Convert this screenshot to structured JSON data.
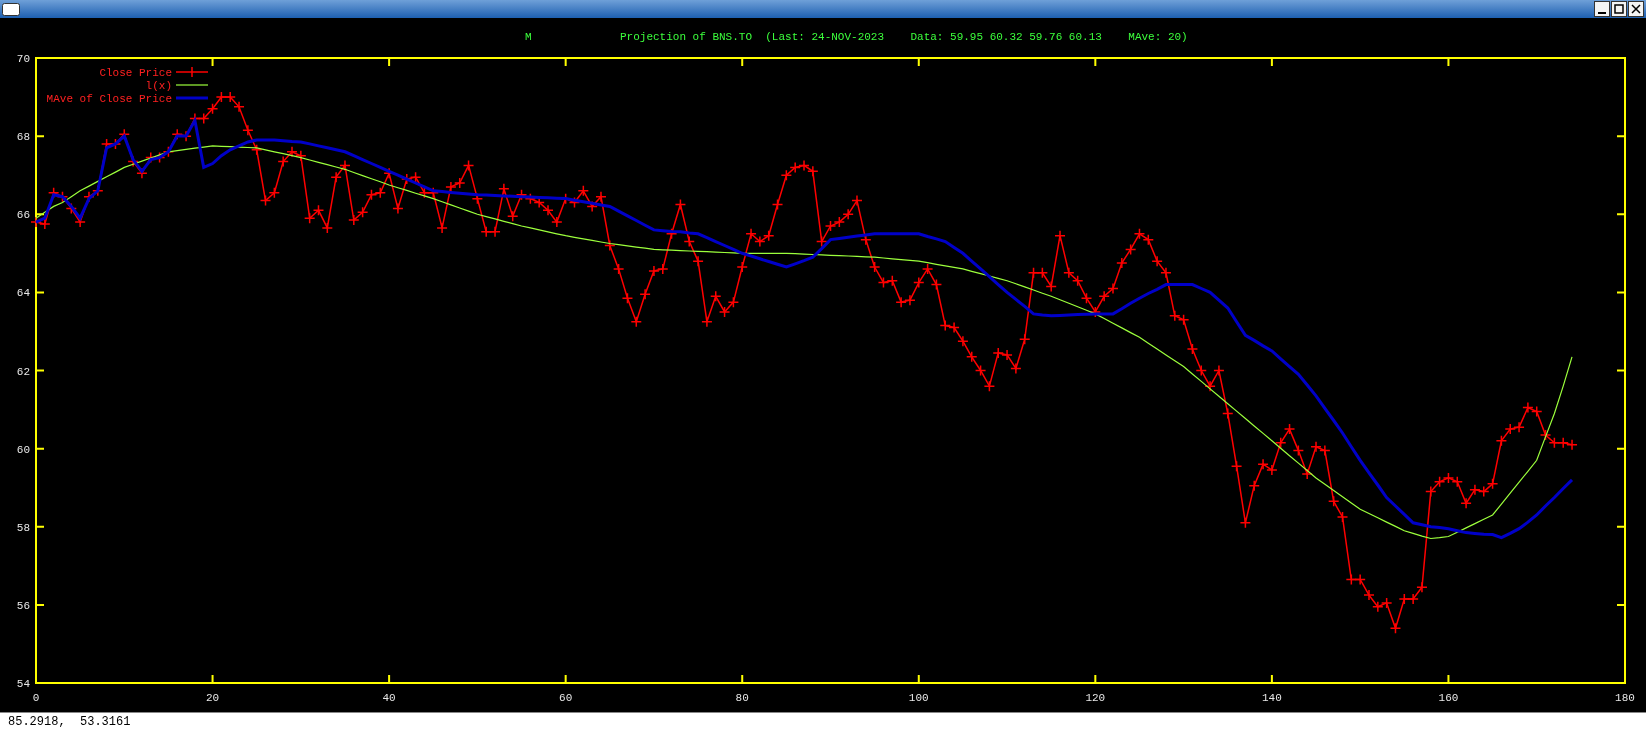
{
  "plot": {
    "corner_label": "M",
    "chart_data": {
      "type": "line",
      "title": "Projection of BNS.TO  (Last: 24-NOV-2023    Data: 59.95 60.32 59.76 60.13    MAve: 20)",
      "xlim": [
        0,
        180
      ],
      "ylim": [
        54,
        70
      ],
      "xticks": [
        0,
        20,
        40,
        60,
        80,
        100,
        120,
        140,
        160,
        180
      ],
      "yticks": [
        54,
        56,
        58,
        60,
        62,
        64,
        66,
        68,
        70
      ],
      "legend": true,
      "x": [
        0,
        1,
        2,
        3,
        4,
        5,
        6,
        7,
        8,
        9,
        10,
        11,
        12,
        13,
        14,
        15,
        16,
        17,
        18,
        19,
        20,
        21,
        22,
        23,
        24,
        25,
        26,
        27,
        28,
        29,
        30,
        31,
        32,
        33,
        34,
        35,
        36,
        37,
        38,
        39,
        40,
        41,
        42,
        43,
        44,
        45,
        46,
        47,
        48,
        49,
        50,
        51,
        52,
        53,
        54,
        55,
        56,
        57,
        58,
        59,
        60,
        61,
        62,
        63,
        64,
        65,
        66,
        67,
        68,
        69,
        70,
        71,
        72,
        73,
        74,
        75,
        76,
        77,
        78,
        79,
        80,
        81,
        82,
        83,
        84,
        85,
        86,
        87,
        88,
        89,
        90,
        91,
        92,
        93,
        94,
        95,
        96,
        97,
        98,
        99,
        100,
        101,
        102,
        103,
        104,
        105,
        106,
        107,
        108,
        109,
        110,
        111,
        112,
        113,
        114,
        115,
        116,
        117,
        118,
        119,
        120,
        121,
        122,
        123,
        124,
        125,
        126,
        127,
        128,
        129,
        130,
        131,
        132,
        133,
        134,
        135,
        136,
        137,
        138,
        139,
        140,
        141,
        142,
        143,
        144,
        145,
        146,
        147,
        148,
        149,
        150,
        151,
        152,
        153,
        154,
        155,
        156,
        157,
        158,
        159,
        160,
        161,
        162,
        163,
        164,
        165,
        166,
        167,
        168,
        169,
        170,
        171,
        172,
        173,
        174
      ],
      "series": [
        {
          "name": "Close Price",
          "color": "#ff0000",
          "marker": "+",
          "values": [
            65.8,
            65.75,
            66.55,
            66.45,
            66.15,
            65.8,
            66.45,
            66.6,
            67.8,
            67.8,
            68.05,
            67.35,
            67.05,
            67.45,
            67.45,
            67.6,
            68.05,
            68.0,
            68.45,
            68.45,
            68.7,
            69.0,
            69.0,
            68.75,
            68.15,
            67.65,
            66.35,
            66.55,
            67.35,
            67.6,
            67.5,
            65.9,
            66.1,
            65.65,
            66.95,
            67.25,
            65.85,
            66.05,
            66.5,
            66.55,
            67.05,
            66.15,
            66.9,
            66.95,
            66.55,
            66.55,
            65.65,
            66.7,
            66.8,
            67.25,
            66.4,
            65.55,
            65.55,
            66.65,
            65.95,
            66.5,
            66.4,
            66.3,
            66.1,
            65.8,
            66.4,
            66.3,
            66.6,
            66.2,
            66.45,
            65.2,
            64.6,
            63.85,
            63.25,
            63.95,
            64.55,
            64.6,
            65.5,
            66.25,
            65.3,
            64.8,
            63.25,
            63.9,
            63.5,
            63.75,
            64.65,
            65.5,
            65.3,
            65.45,
            66.25,
            67.0,
            67.2,
            67.25,
            67.1,
            65.3,
            65.7,
            65.8,
            66.0,
            66.35,
            65.35,
            64.65,
            64.25,
            64.3,
            63.75,
            63.8,
            64.25,
            64.6,
            64.2,
            63.15,
            63.1,
            62.75,
            62.35,
            62.0,
            61.6,
            62.45,
            62.4,
            62.05,
            62.8,
            64.5,
            64.5,
            64.15,
            65.45,
            64.5,
            64.3,
            63.85,
            63.5,
            63.9,
            64.1,
            64.75,
            65.1,
            65.5,
            65.35,
            64.8,
            64.5,
            63.4,
            63.3,
            62.55,
            62.0,
            61.6,
            62.0,
            60.9,
            59.55,
            58.1,
            59.05,
            59.6,
            59.45,
            60.15,
            60.5,
            59.95,
            59.35,
            60.05,
            59.95,
            58.65,
            58.25,
            56.65,
            56.65,
            56.25,
            55.95,
            56.05,
            55.4,
            56.15,
            56.15,
            56.45,
            58.9,
            59.15,
            59.25,
            59.15,
            58.6,
            58.95,
            58.9,
            59.1,
            60.2,
            60.5,
            60.55,
            61.05,
            60.95,
            60.35,
            60.15,
            60.15,
            60.1
          ]
        },
        {
          "name": "l(x)",
          "color": "#9cff3c",
          "values": [
            65.9,
            66.05,
            66.2,
            66.3,
            66.45,
            66.6,
            66.72,
            66.84,
            66.96,
            67.08,
            67.2,
            67.28,
            67.36,
            67.44,
            67.52,
            67.6,
            67.63,
            67.66,
            67.69,
            67.72,
            67.75,
            67.74,
            67.73,
            67.72,
            67.71,
            67.7,
            67.65,
            67.6,
            67.55,
            67.5,
            67.45,
            67.39,
            67.33,
            67.27,
            67.21,
            67.15,
            67.07,
            66.99,
            66.91,
            66.83,
            66.75,
            66.68,
            66.61,
            66.54,
            66.47,
            66.4,
            66.32,
            66.24,
            66.16,
            66.08,
            66.0,
            65.94,
            65.88,
            65.82,
            65.76,
            65.7,
            65.65,
            65.6,
            65.55,
            65.5,
            65.45,
            65.41,
            65.37,
            65.33,
            65.29,
            65.25,
            65.22,
            65.19,
            65.16,
            65.13,
            65.1,
            65.09,
            65.08,
            65.07,
            65.06,
            65.05,
            65.04,
            65.03,
            65.02,
            65.01,
            65.0,
            65.0,
            65.0,
            65.0,
            65.0,
            65.0,
            64.99,
            64.98,
            64.97,
            64.96,
            64.95,
            64.94,
            64.93,
            64.92,
            64.91,
            64.9,
            64.88,
            64.86,
            64.84,
            64.82,
            64.8,
            64.76,
            64.72,
            64.68,
            64.64,
            64.6,
            64.54,
            64.48,
            64.42,
            64.36,
            64.3,
            64.22,
            64.14,
            64.06,
            63.98,
            63.9,
            63.81,
            63.72,
            63.63,
            63.54,
            63.45,
            63.33,
            63.21,
            63.09,
            62.97,
            62.85,
            62.7,
            62.55,
            62.4,
            62.25,
            62.1,
            61.91,
            61.72,
            61.53,
            61.34,
            61.15,
            60.96,
            60.77,
            60.58,
            60.39,
            60.2,
            60.01,
            59.82,
            59.63,
            59.44,
            59.25,
            59.09,
            58.93,
            58.77,
            58.61,
            58.45,
            58.34,
            58.23,
            58.12,
            58.01,
            57.9,
            57.83,
            57.76,
            57.7,
            57.72,
            57.75,
            57.86,
            57.97,
            58.08,
            58.19,
            58.3,
            58.58,
            58.86,
            59.14,
            59.42,
            59.7,
            60.3,
            60.9,
            61.6,
            62.35
          ]
        },
        {
          "name": "MAve of Close Price",
          "color": "#0000c8",
          "values": [
            65.8,
            65.9,
            66.5,
            66.45,
            66.2,
            65.9,
            66.4,
            66.6,
            67.7,
            67.8,
            68.0,
            67.4,
            67.1,
            67.4,
            67.45,
            67.6,
            68.0,
            68.0,
            68.4,
            67.2,
            67.3,
            67.5,
            67.65,
            67.75,
            67.85,
            67.9,
            67.9,
            67.9,
            67.88,
            67.86,
            67.85,
            67.8,
            67.75,
            67.7,
            67.65,
            67.6,
            67.5,
            67.4,
            67.3,
            67.2,
            67.1,
            67.0,
            66.9,
            66.8,
            66.7,
            66.6,
            66.58,
            66.56,
            66.54,
            66.52,
            66.5,
            66.49,
            66.48,
            66.47,
            66.46,
            66.45,
            66.44,
            66.43,
            66.42,
            66.41,
            66.4,
            66.36,
            66.32,
            66.28,
            66.24,
            66.2,
            66.08,
            65.96,
            65.84,
            65.72,
            65.6,
            65.58,
            65.56,
            65.55,
            65.52,
            65.5,
            65.4,
            65.3,
            65.2,
            65.1,
            65.0,
            64.93,
            64.86,
            64.79,
            64.72,
            64.65,
            64.73,
            64.81,
            64.9,
            65.12,
            65.35,
            65.38,
            65.41,
            65.44,
            65.47,
            65.5,
            65.5,
            65.5,
            65.5,
            65.5,
            65.5,
            65.43,
            65.37,
            65.3,
            65.15,
            65.0,
            64.8,
            64.6,
            64.4,
            64.2,
            64.0,
            63.82,
            63.64,
            63.45,
            63.42,
            63.4,
            63.41,
            63.42,
            63.43,
            63.44,
            63.45,
            63.45,
            63.45,
            63.58,
            63.72,
            63.85,
            63.97,
            64.08,
            64.2,
            64.2,
            64.2,
            64.2,
            64.1,
            64.0,
            63.8,
            63.6,
            63.25,
            62.9,
            62.77,
            62.63,
            62.5,
            62.3,
            62.1,
            61.9,
            61.63,
            61.35,
            61.03,
            60.72,
            60.4,
            60.05,
            59.7,
            59.38,
            59.07,
            58.75,
            58.53,
            58.32,
            58.1,
            58.05,
            58.0,
            57.98,
            57.95,
            57.9,
            57.85,
            57.83,
            57.81,
            57.8,
            57.72,
            57.83,
            57.95,
            58.12,
            58.3,
            58.53,
            58.75,
            58.98,
            59.2
          ]
        }
      ]
    }
  },
  "status_bar": {
    "text": "85.2918,  53.3161"
  }
}
